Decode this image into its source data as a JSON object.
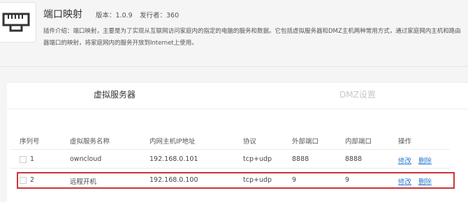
{
  "app": {
    "title": "端口映射",
    "version": "版本：1.0.9",
    "publisher": "发行者：360",
    "description_line1": "插件介绍：端口映射，主要是为了实现从互联网访问家庭内的指定的电脑的服务和数据。它包括虚拟服务器和DMZ主机两种常用方式，通过家庭网内主机和路由",
    "description_line2": "器端口的映射，将家庭网内的服务开放到Internet上使用。",
    "icon": "ethernet-port-icon"
  },
  "tabs": [
    {
      "label": "虚拟服务器",
      "active": true
    },
    {
      "label": "DMZ设置",
      "active": false
    }
  ],
  "table": {
    "headers": [
      "序列号",
      "虚拟服务名称",
      "内网主机IP地址",
      "协议",
      "外部端口",
      "内部端口",
      "操作"
    ],
    "rows": [
      {
        "index": "1",
        "name": "owncloud",
        "ip": "192.168.0.101",
        "protocol": "tcp+udp",
        "external_port": "8888",
        "internal_port": "8888",
        "edit": "修改",
        "delete": "删除"
      },
      {
        "index": "2",
        "name": "远程开机",
        "ip": "192.168.0.100",
        "protocol": "tcp+udp",
        "external_port": "9",
        "internal_port": "9",
        "edit": "修改",
        "delete": "删除"
      }
    ]
  },
  "colors": {
    "highlight": "#c9353a",
    "link": "#2a7ad2"
  }
}
